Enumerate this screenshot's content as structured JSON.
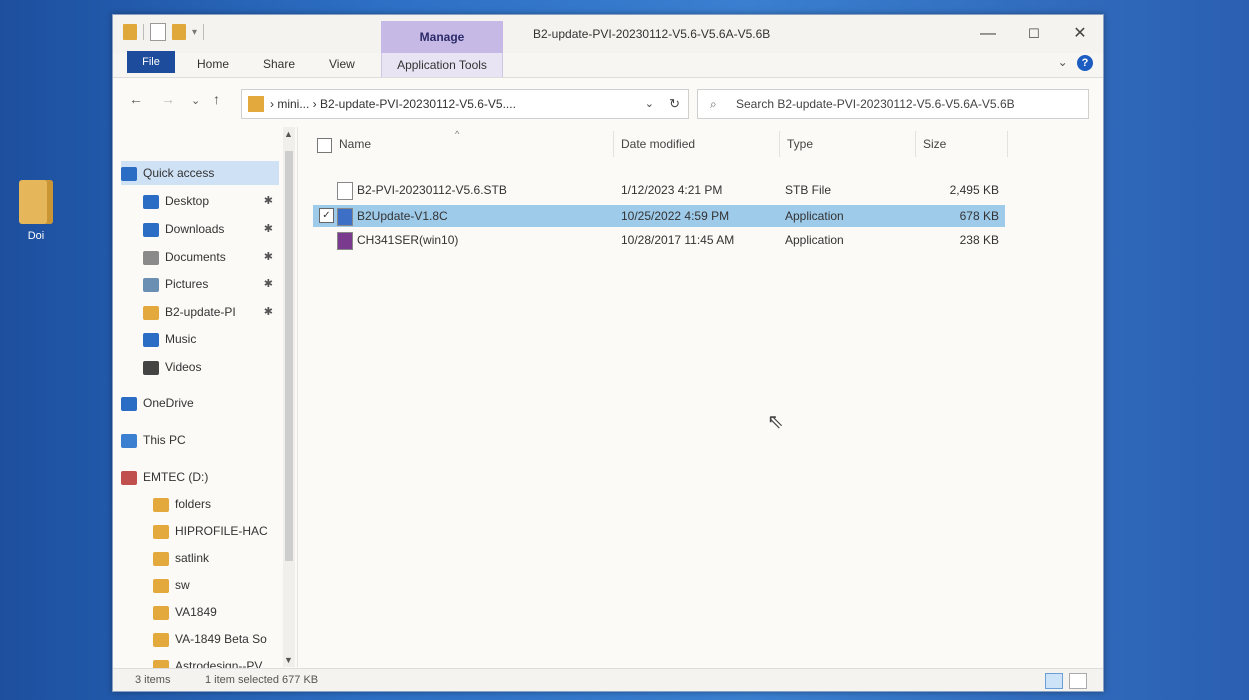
{
  "desktop": {
    "icon_label": "Doi"
  },
  "window": {
    "title": "B2-update-PVI-20230112-V5.6-V5.6A-V5.6B",
    "manage_tab": "Manage",
    "controls": {
      "minimize": "—",
      "maximize": "☐",
      "close": "✕"
    }
  },
  "ribbon": {
    "file": "File",
    "home": "Home",
    "share": "Share",
    "view": "View",
    "app_tools": "Application Tools",
    "help_chevron": "⌄",
    "help": "?"
  },
  "nav": {
    "back": "←",
    "forward": "→",
    "recent": "⌄",
    "up": "↑",
    "address": "› mini... › B2-update-PVI-20230112-V5.6-V5....",
    "address_dropdown": "⌄",
    "refresh": "↻",
    "search_icon": "⌕",
    "search_placeholder": "Search B2-update-PVI-20230112-V5.6-V5.6A-V5.6B"
  },
  "sidebar": {
    "items": [
      {
        "label": "Quick access",
        "icon": "star-icon",
        "color": "#2b6cc4",
        "pin": ""
      },
      {
        "label": "Desktop",
        "icon": "desktop-icon",
        "color": "#2b6cc4",
        "pin": "✱"
      },
      {
        "label": "Downloads",
        "icon": "download-icon",
        "color": "#2b6cc4",
        "pin": "✱"
      },
      {
        "label": "Documents",
        "icon": "document-icon",
        "color": "#8a8a8a",
        "pin": "✱"
      },
      {
        "label": "Pictures",
        "icon": "picture-icon",
        "color": "#6b8fb3",
        "pin": "✱"
      },
      {
        "label": "B2-update-PI",
        "icon": "folder-icon",
        "color": "#e3a93d",
        "pin": "✱"
      },
      {
        "label": "Music",
        "icon": "music-icon",
        "color": "#2b6cc4",
        "pin": ""
      },
      {
        "label": "Videos",
        "icon": "video-icon",
        "color": "#444444",
        "pin": ""
      },
      {
        "label": "OneDrive",
        "icon": "cloud-icon",
        "color": "#2b6cc4",
        "pin": ""
      },
      {
        "label": "This PC",
        "icon": "computer-icon",
        "color": "#3a7fd0",
        "pin": ""
      },
      {
        "label": "EMTEC (D:)",
        "icon": "drive-icon",
        "color": "#c0504d",
        "pin": ""
      },
      {
        "label": "folders",
        "icon": "folder-icon",
        "color": "#e3a93d",
        "pin": ""
      },
      {
        "label": "HIPROFILE-HAC",
        "icon": "folder-icon",
        "color": "#e3a93d",
        "pin": ""
      },
      {
        "label": "satlink",
        "icon": "folder-icon",
        "color": "#e3a93d",
        "pin": ""
      },
      {
        "label": "sw",
        "icon": "folder-icon",
        "color": "#e3a93d",
        "pin": ""
      },
      {
        "label": "VA1849",
        "icon": "folder-icon",
        "color": "#e3a93d",
        "pin": ""
      },
      {
        "label": "VA-1849 Beta So",
        "icon": "folder-icon",
        "color": "#e3a93d",
        "pin": ""
      },
      {
        "label": "Astrodesign--PV",
        "icon": "folder-icon",
        "color": "#e3a93d",
        "pin": ""
      }
    ],
    "scroll_up": "▲",
    "scroll_down": "▼"
  },
  "table": {
    "columns": [
      "Name",
      "Date modified",
      "Type",
      "Size"
    ],
    "sort_indicator": "^",
    "rows": [
      {
        "name": "B2-PVI-20230112-V5.6.STB",
        "date": "1/12/2023 4:21 PM",
        "type": "STB File",
        "size": "2,495 KB",
        "icon": "file-icon",
        "selected": false
      },
      {
        "name": "B2Update-V1.8C",
        "date": "10/25/2022 4:59 PM",
        "type": "Application",
        "size": "678 KB",
        "icon": "app-icon",
        "selected": true
      },
      {
        "name": "CH341SER(win10)",
        "date": "10/28/2017 11:45 AM",
        "type": "Application",
        "size": "238 KB",
        "icon": "installer-icon",
        "selected": false
      }
    ],
    "selected_check": "✓"
  },
  "status": {
    "item_count": "3 items",
    "selection": "1 item selected  677 KB"
  },
  "colors": {
    "selection": "#9fcbea",
    "manage_tab": "#c7b9e6",
    "file_tab": "#1d4c9c"
  }
}
